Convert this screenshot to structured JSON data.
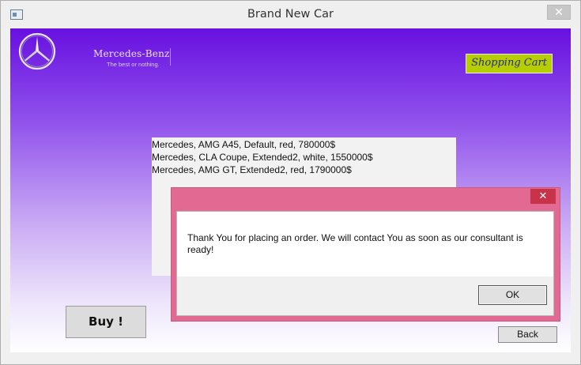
{
  "window": {
    "title": "Brand New Car",
    "close_glyph": "✕"
  },
  "brand": {
    "name": "Mercedes-Benz",
    "tagline": "The best or nothing.",
    "logo_icon": "mercedes-star-icon"
  },
  "header": {
    "cart_label": "Shopping Cart"
  },
  "orders": [
    "Mercedes, AMG A45, Default, red, 780000$",
    "Mercedes, CLA Coupe, Extended2, white, 1550000$",
    "Mercedes, AMG GT, Extended2, red, 1790000$"
  ],
  "actions": {
    "buy_label": "Buy !",
    "back_label": "Back"
  },
  "dialog": {
    "close_glyph": "✕",
    "message": "Thank You for placing an order. We will contact You as soon as our consultant is ready!",
    "ok_label": "OK"
  },
  "colors": {
    "gradient_top": "#6810e0",
    "gradient_bottom": "#ffffff",
    "cart_button": "#b6cd00",
    "dialog_frame": "#e26a92",
    "dialog_close": "#c8334a"
  }
}
